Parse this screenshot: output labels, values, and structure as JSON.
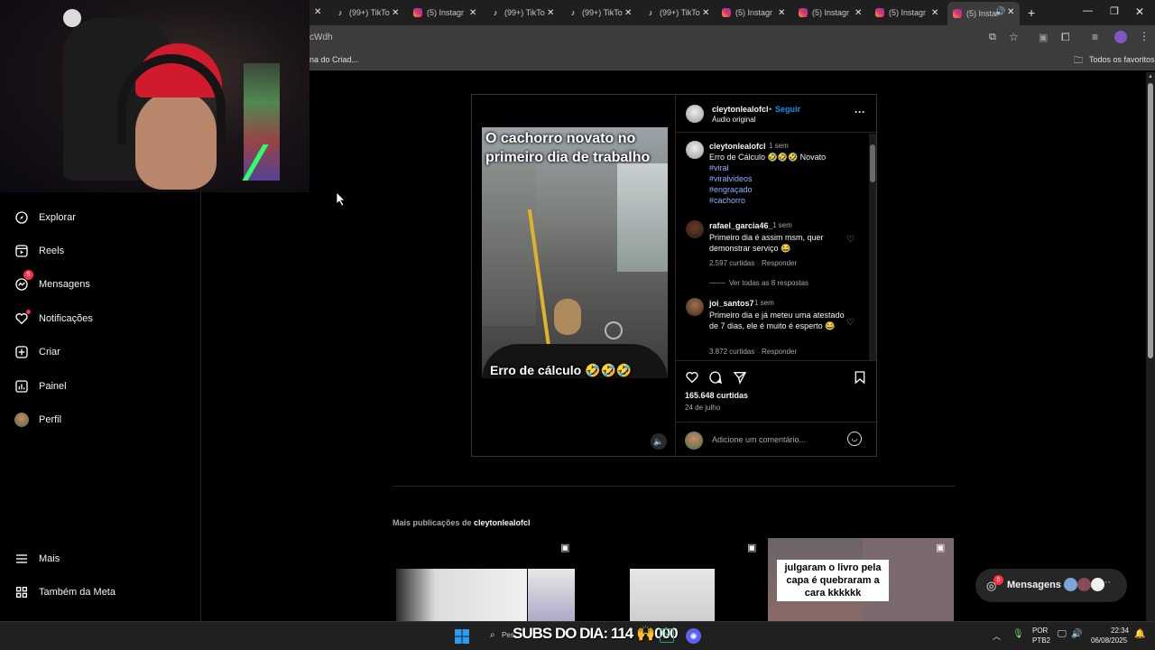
{
  "tabs": [
    {
      "label": "(99+) TikTo",
      "icon": "tiktok-icon"
    },
    {
      "label": "(5) Instagr",
      "icon": "instagram-icon"
    },
    {
      "label": "(99+) TikTo",
      "icon": "tiktok-icon"
    },
    {
      "label": "(99+) TikTo",
      "icon": "tiktok-icon"
    },
    {
      "label": "(99+) TikTo",
      "icon": "tiktok-icon"
    },
    {
      "label": "(5) Instagr",
      "icon": "instagram-icon"
    },
    {
      "label": "(5) Instagr",
      "icon": "instagram-icon"
    },
    {
      "label": "(5) Instagr",
      "icon": "instagram-icon"
    },
    {
      "label": "(5) Insta",
      "icon": "instagram-icon"
    }
  ],
  "address": {
    "url_fragment": "cWdh"
  },
  "bookmarks": {
    "left": "na do Criad...",
    "right": "Todos os favoritos"
  },
  "sidebar": {
    "items": [
      {
        "label": "Explorar",
        "icon": "compass-icon"
      },
      {
        "label": "Reels",
        "icon": "reels-icon"
      },
      {
        "label": "Mensagens",
        "icon": "messenger-icon",
        "badge": "5"
      },
      {
        "label": "Notificações",
        "icon": "heart-icon"
      },
      {
        "label": "Criar",
        "icon": "plus-square-icon"
      },
      {
        "label": "Painel",
        "icon": "chart-icon"
      },
      {
        "label": "Perfil",
        "icon": "avatar-icon"
      }
    ],
    "more": "Mais",
    "meta": "Também da Meta"
  },
  "post": {
    "video_caption_top": "O cachorro novato no primeiro dia de trabalho",
    "video_caption_bottom": "Erro de cálculo 🤣🤣🤣",
    "author": "cleytonlealofcl",
    "follow": "Seguir",
    "separator": "•",
    "audio": "Áudio original",
    "caption": {
      "user": "cleytonlealofcl",
      "time": "1 sem",
      "text": "Erro de Cálculo 🤣🤣🤣 Novato",
      "hashtags": [
        "#viral",
        "#viralvideos",
        "#engraçado",
        "#cachorro"
      ]
    },
    "comments": [
      {
        "user": "rafael_garcia46_",
        "time": "1 sem",
        "text": "Primeiro dia é assim msm, quer demonstrar serviço 😂",
        "likes": "2.597 curtidas",
        "reply": "Responder",
        "view_replies": "Ver todas as 8 respostas"
      },
      {
        "user": "joi_santos7",
        "time": "1 sem",
        "text": "Primeiro dia e já meteu uma atestado de 7 dias, ele é muito é esperto 😂",
        "likes": "3.872 curtidas",
        "reply": "Responder"
      }
    ],
    "likes": "165.648 curtidas",
    "date": "24 de julho",
    "comment_placeholder": "Adicione um comentário..."
  },
  "more_posts": {
    "prefix": "Mais publicações de ",
    "user": "cleytonlealofcl",
    "thumb3_text": "julgaram o livro pela capa é quebraram a cara kkkkkk"
  },
  "floating": {
    "label": "Mensagens",
    "badge": "5"
  },
  "taskbar": {
    "search_placeholder": "Pes",
    "overlay": "SUBS DO DIA: 114 🙌000",
    "lang": "POR",
    "lang2": "PTB2",
    "time": "22:34",
    "date": "06/08/2025"
  },
  "colors": {
    "accent": "#0095f6",
    "hashtag": "#8ab4ff",
    "badge": "#ff3040"
  }
}
